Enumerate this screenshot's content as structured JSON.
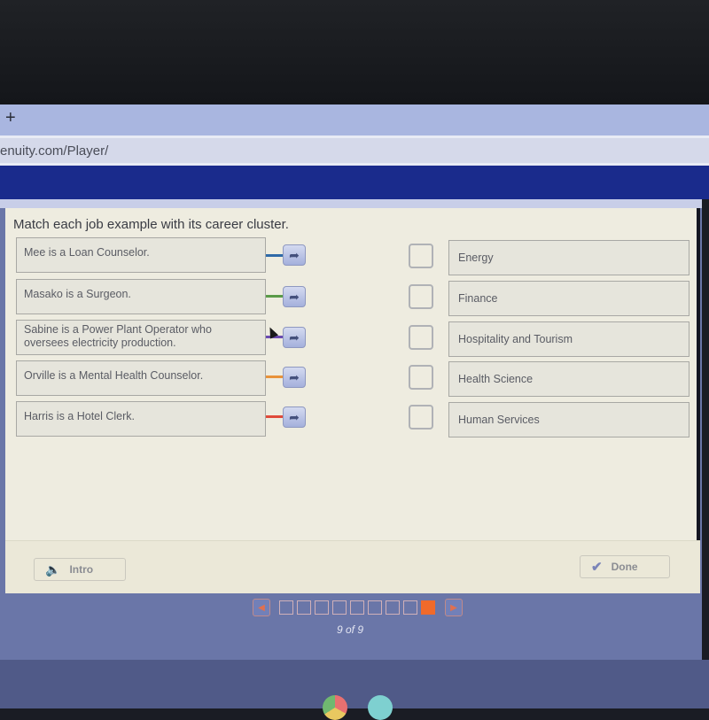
{
  "browser": {
    "new_tab_glyph": "+",
    "url": "enuity.com/Player/"
  },
  "activity": {
    "instruction": "Match each job example with its career cluster.",
    "prompts": [
      {
        "text": "Mee is a Loan Counselor.",
        "connector_color": "#2f6aa8"
      },
      {
        "text": "Masako is a Surgeon.",
        "connector_color": "#5a9a48"
      },
      {
        "text": "Sabine is a Power Plant Operator who oversees electricity production.",
        "connector_color": "#6a4ab0"
      },
      {
        "text": "Orville is a Mental Health Counselor.",
        "connector_color": "#e8923a"
      },
      {
        "text": "Harris is a Hotel Clerk.",
        "connector_color": "#e04a3a"
      }
    ],
    "arrow_glyph": "➦",
    "answers": [
      {
        "text": "Energy"
      },
      {
        "text": "Finance"
      },
      {
        "text": "Hospitality and Tourism"
      },
      {
        "text": "Health Science"
      },
      {
        "text": "Human Services"
      }
    ]
  },
  "footer": {
    "intro_label": "Intro",
    "intro_icon": "speaker-icon",
    "done_label": "Done",
    "done_icon": "check-icon"
  },
  "pager": {
    "prev_glyph": "◀",
    "next_glyph": "▶",
    "current_page": 9,
    "total_pages": 9,
    "label": "9 of 9"
  },
  "colors": {
    "header_bar": "#1a2b8c",
    "active_page": "#f06a2a"
  }
}
